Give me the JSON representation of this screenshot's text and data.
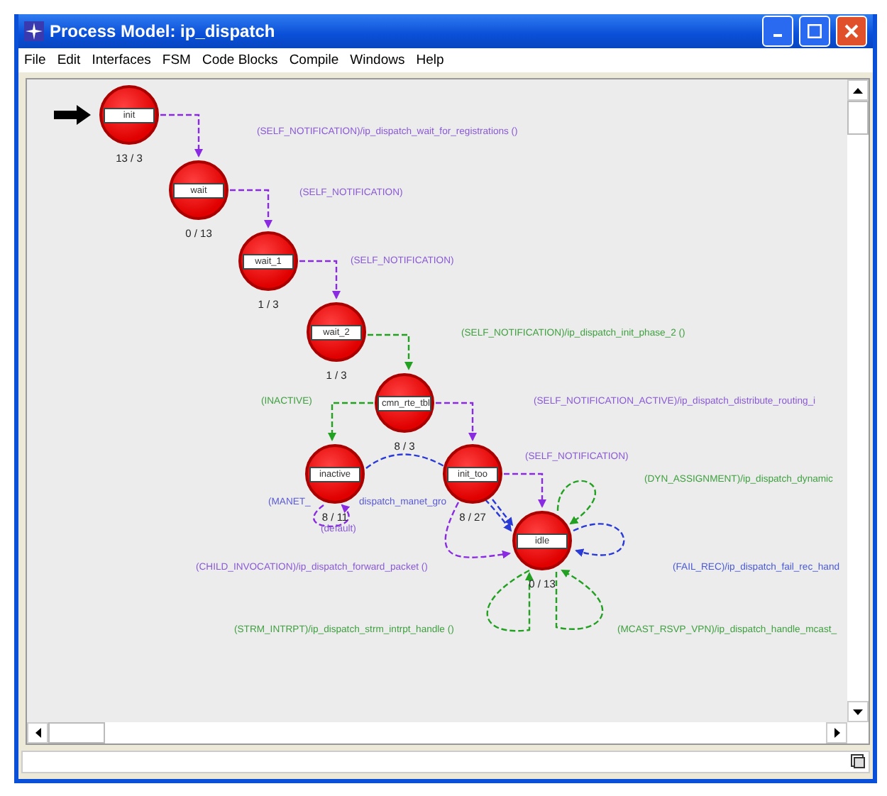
{
  "window": {
    "title": "Process Model: ip_dispatch"
  },
  "menu": [
    "File",
    "Edit",
    "Interfaces",
    "FSM",
    "Code Blocks",
    "Compile",
    "Windows",
    "Help"
  ],
  "states": [
    {
      "name": "init",
      "count": "13 / 3"
    },
    {
      "name": "wait",
      "count": "0 / 13"
    },
    {
      "name": "wait_1",
      "count": "1 / 3"
    },
    {
      "name": "wait_2",
      "count": "1 / 3"
    },
    {
      "name": "cmn_rte_tbl",
      "count": "8 / 3"
    },
    {
      "name": "inactive",
      "count": "8 / 11"
    },
    {
      "name": "init_too",
      "count": "8 / 27"
    },
    {
      "name": "idle",
      "count": "0 / 13"
    }
  ],
  "transition_labels": [
    {
      "text": "(SELF_NOTIFICATION)/ip_dispatch_wait_for_registrations ()",
      "color": "#8a5ad6"
    },
    {
      "text": "(SELF_NOTIFICATION)",
      "color": "#8a5ad6"
    },
    {
      "text": "(SELF_NOTIFICATION)",
      "color": "#8a5ad6"
    },
    {
      "text": "(SELF_NOTIFICATION)/ip_dispatch_init_phase_2 ()",
      "color": "#3fa040"
    },
    {
      "text": "(INACTIVE)",
      "color": "#3fa040"
    },
    {
      "text": "(SELF_NOTIFICATION_ACTIVE)/ip_dispatch_distribute_routing_i",
      "color": "#8a5ad6"
    },
    {
      "text": "(SELF_NOTIFICATION)",
      "color": "#8a5ad6"
    },
    {
      "text": "(DYN_ASSIGNMENT)/ip_dispatch_dynamic",
      "color": "#3fa040"
    },
    {
      "text": "(MANET_",
      "color": "#5a5ad6"
    },
    {
      "text": "dispatch_manet_gro",
      "color": "#5a5ad6"
    },
    {
      "text": "(default)",
      "color": "#8a5ad6"
    },
    {
      "text": "(CHILD_INVOCATION)/ip_dispatch_forward_packet ()",
      "color": "#8a5ad6"
    },
    {
      "text": "(FAIL_REC)/ip_dispatch_fail_rec_hand",
      "color": "#4a5ad6"
    },
    {
      "text": "(STRM_INTRPT)/ip_dispatch_strm_intrpt_handle ()",
      "color": "#3fa040"
    },
    {
      "text": "(MCAST_RSVP_VPN)/ip_dispatch_handle_mcast_",
      "color": "#3fa040"
    }
  ]
}
